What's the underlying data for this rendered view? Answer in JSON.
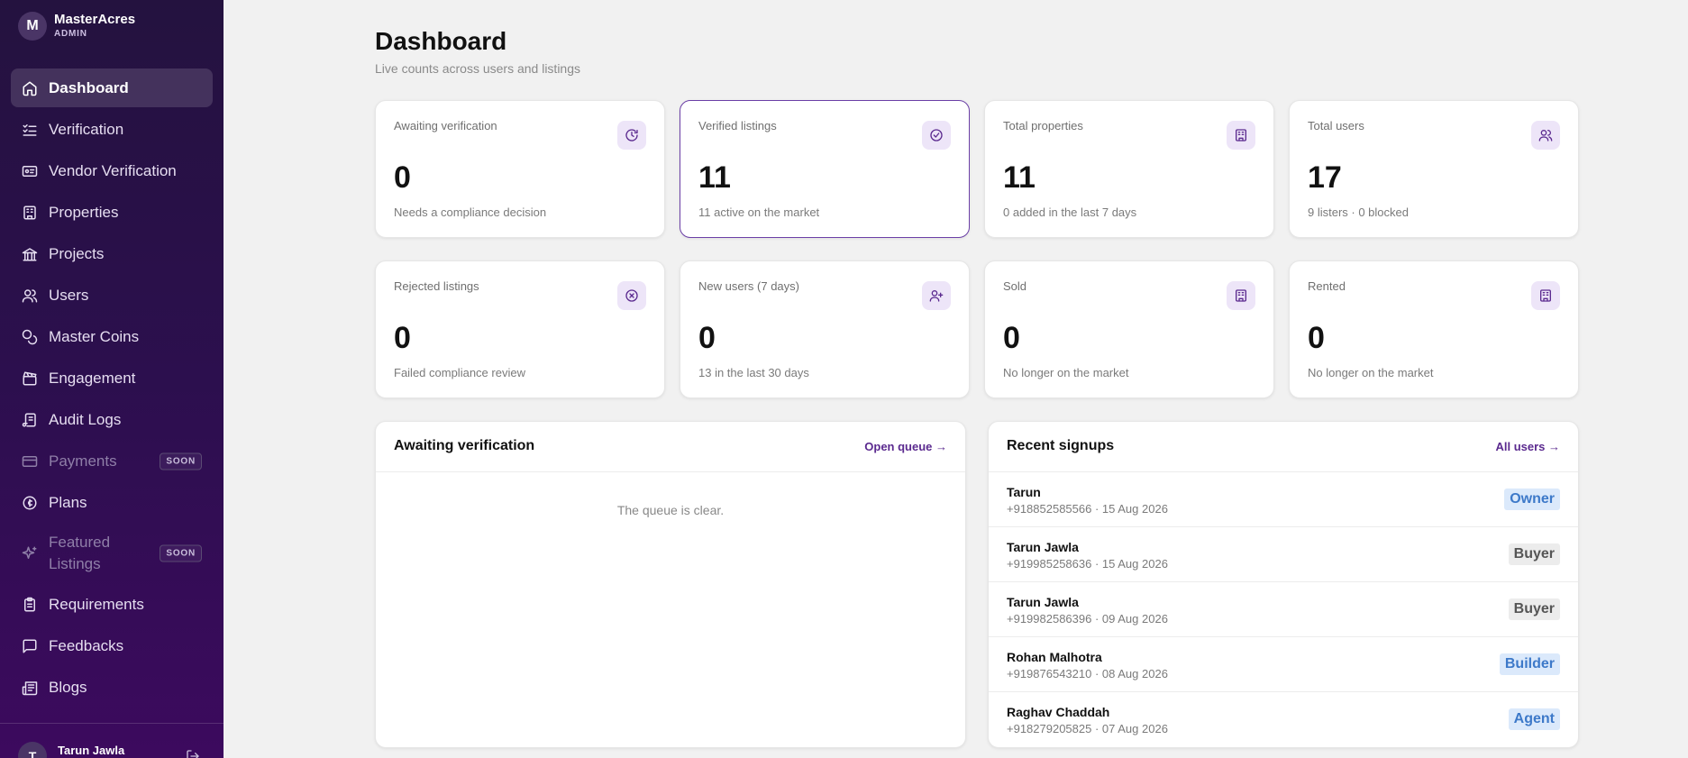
{
  "app": {
    "initial": "M",
    "name": "MasterAcres",
    "role": "ADMIN"
  },
  "nav": [
    {
      "label": "Dashboard",
      "icon": "home-icon",
      "active": true
    },
    {
      "label": "Verification",
      "icon": "list-check-icon"
    },
    {
      "label": "Vendor Verification",
      "icon": "id-card-icon"
    },
    {
      "label": "Properties",
      "icon": "building-icon"
    },
    {
      "label": "Projects",
      "icon": "landmark-icon"
    },
    {
      "label": "Users",
      "icon": "users-icon"
    },
    {
      "label": "Master Coins",
      "icon": "coins-icon"
    },
    {
      "label": "Engagement",
      "icon": "clapperboard-icon"
    },
    {
      "label": "Audit Logs",
      "icon": "scroll-icon"
    },
    {
      "label": "Payments",
      "icon": "credit-card-icon",
      "badge": "SOON",
      "disabled": true
    },
    {
      "label": "Plans",
      "icon": "badge-cent-icon"
    },
    {
      "label": "Featured Listings",
      "icon": "sparkles-icon",
      "badge": "SOON",
      "disabled": true
    },
    {
      "label": "Requirements",
      "icon": "clipboard-icon"
    },
    {
      "label": "Feedbacks",
      "icon": "message-square-icon"
    },
    {
      "label": "Blogs",
      "icon": "newspaper-icon"
    }
  ],
  "footer_user": {
    "initial": "T",
    "name": "Tarun Jawla"
  },
  "page": {
    "title": "Dashboard",
    "subtitle": "Live counts across users and listings"
  },
  "stats": [
    {
      "label": "Awaiting verification",
      "value": "0",
      "note": "Needs a compliance decision",
      "icon": "clock-icon"
    },
    {
      "label": "Verified listings",
      "value": "11",
      "note": "11 active on the market",
      "icon": "check-circle-icon"
    },
    {
      "label": "Total properties",
      "value": "11",
      "note": "0 added in the last 7 days",
      "icon": "building-icon"
    },
    {
      "label": "Total users",
      "value": "17",
      "note": "9 listers · 0 blocked",
      "icon": "users-icon"
    },
    {
      "label": "Rejected listings",
      "value": "0",
      "note": "Failed compliance review",
      "icon": "x-circle-icon"
    },
    {
      "label": "New users (7 days)",
      "value": "0",
      "note": "13 in the last 30 days",
      "icon": "user-plus-icon"
    },
    {
      "label": "Sold",
      "value": "0",
      "note": "No longer on the market",
      "icon": "building-icon"
    },
    {
      "label": "Rented",
      "value": "0",
      "note": "No longer on the market",
      "icon": "building-icon"
    }
  ],
  "queue_panel": {
    "title": "Awaiting verification",
    "link": "Open queue →",
    "empty": "The queue is clear."
  },
  "signups_panel": {
    "title": "Recent signups",
    "link": "All users →",
    "rows": [
      {
        "name": "Tarun",
        "meta": "+918852585566 · 15 Aug 2026",
        "role": "Owner"
      },
      {
        "name": "Tarun Jawla",
        "meta": "+919985258636 · 15 Aug 2026",
        "role": "Buyer"
      },
      {
        "name": "Tarun Jawla",
        "meta": "+919982586396 · 09 Aug 2026",
        "role": "Buyer"
      },
      {
        "name": "Rohan Malhotra",
        "meta": "+919876543210 · 08 Aug 2026",
        "role": "Builder"
      },
      {
        "name": "Raghav Chaddah",
        "meta": "+918279205825 · 07 Aug 2026",
        "role": "Agent"
      }
    ]
  },
  "colors": {
    "accent": "#5b2a8f",
    "sidebar_top": "#24123f",
    "sidebar_bottom": "#3c0a5e",
    "icon_bg": "#ede5f8"
  }
}
